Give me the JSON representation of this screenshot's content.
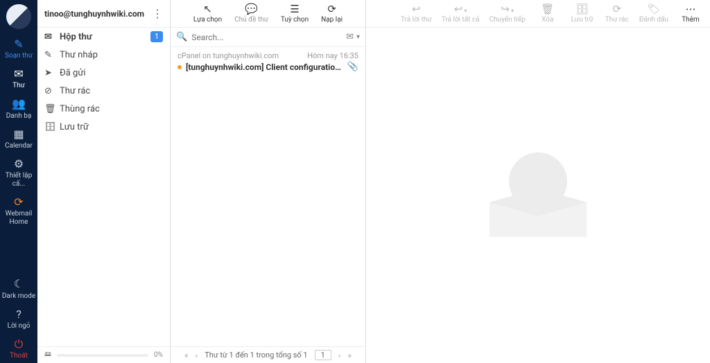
{
  "nav": {
    "compose": "Soạn thư",
    "mail": "Thư",
    "contacts": "Danh bạ",
    "calendar": "Calendar",
    "settings": "Thiết lập cấ...",
    "webmail": "Webmail Home",
    "darkmode": "Dark mode",
    "greeting": "Lời ngỏ",
    "logout": "Thoát"
  },
  "account": {
    "email": "tinoo@tunghuynhwiki.com"
  },
  "folders": [
    {
      "label": "Hộp thư",
      "badge": "1",
      "selected": true
    },
    {
      "label": "Thư nháp"
    },
    {
      "label": "Đã gửi"
    },
    {
      "label": "Thư rác"
    },
    {
      "label": "Thùng rác"
    },
    {
      "label": "Lưu trữ"
    }
  ],
  "quota": {
    "pct": "0%"
  },
  "listToolbar": {
    "select": "Lựa chọn",
    "threads": "Chủ đề thư",
    "options": "Tuỳ chọn",
    "refresh": "Nạp lại"
  },
  "search": {
    "placeholder": "Search..."
  },
  "messages": [
    {
      "from": "cPanel on tunghuynhwiki.com",
      "time": "Hôm nay 16:35",
      "subject": "[tunghuynhwiki.com] Client configuration settings f...",
      "unread": true,
      "attachment": true
    }
  ],
  "pager": {
    "summary": "Thư từ 1 đến 1 trong tổng số 1",
    "page": "1"
  },
  "msgToolbar": {
    "reply": "Trả lời thư",
    "replyall": "Trả lời tất cả",
    "forward": "Chuyển tiếp",
    "delete": "Xóa",
    "archive": "Lưu trữ",
    "junk": "Thư rác",
    "mark": "Đánh dấu",
    "more": "Thêm"
  }
}
